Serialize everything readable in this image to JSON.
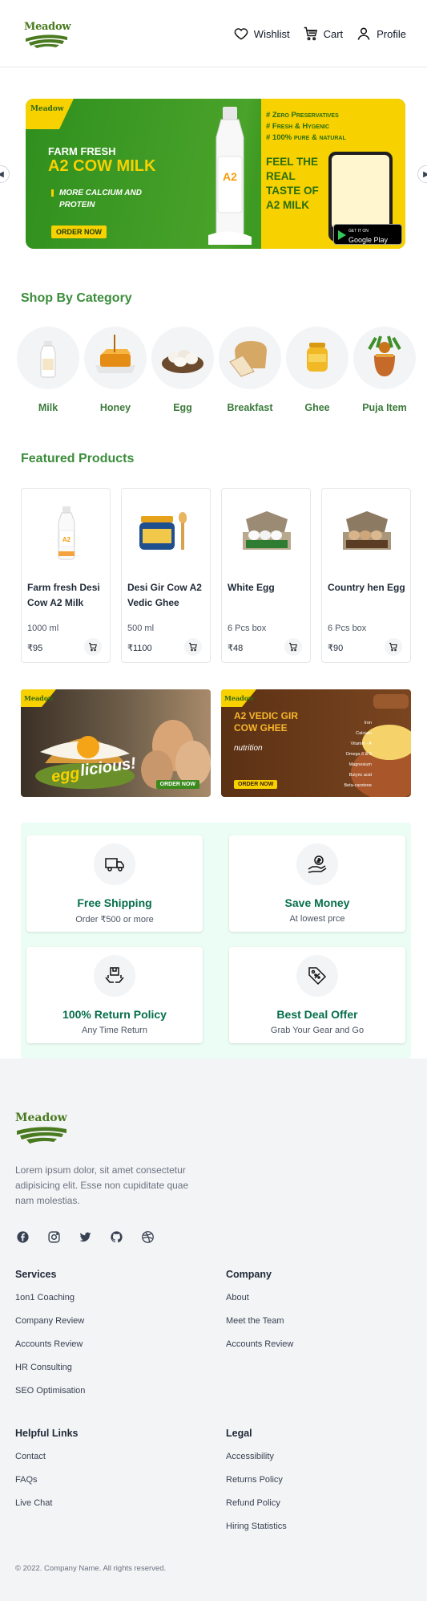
{
  "header": {
    "logo": "Meadow",
    "nav": [
      {
        "label": "Wishlist",
        "icon": "heart-icon"
      },
      {
        "label": "Cart",
        "icon": "cart-icon"
      },
      {
        "label": "Profile",
        "icon": "user-icon"
      }
    ]
  },
  "banner": {
    "badge": "Meadow",
    "line1": "FARM FRESH",
    "line2": "A2 COW MILK",
    "sub": "MORE CALCIUM AND PROTEIN",
    "cta": "ORDER NOW",
    "points": [
      "# Zero Preservatives",
      "# Fresh & Hygenic",
      "# 100% pure & natural"
    ],
    "feel": "FEEL THE REAL TASTE OF A2 MILK",
    "store_small": "GET IT ON",
    "store": "Google Play",
    "colors": {
      "green": "#3d9a22",
      "yellow": "#f7d100"
    }
  },
  "categories": {
    "title": "Shop By Category",
    "items": [
      {
        "label": "Milk"
      },
      {
        "label": "Honey"
      },
      {
        "label": "Egg"
      },
      {
        "label": "Breakfast"
      },
      {
        "label": "Ghee"
      },
      {
        "label": "Puja Item"
      }
    ]
  },
  "featured": {
    "title": "Featured Products",
    "products": [
      {
        "name": "Farm fresh Desi Cow A2 Milk",
        "unit": "1000 ml",
        "price": "₹95"
      },
      {
        "name": "Desi Gir Cow A2 Vedic Ghee",
        "unit": "500 ml",
        "price": "₹1100"
      },
      {
        "name": "White Egg",
        "unit": "6 Pcs box",
        "price": "₹48"
      },
      {
        "name": "Country hen Egg",
        "unit": "6 Pcs box",
        "price": "₹90"
      }
    ]
  },
  "promos": [
    {
      "text1": "egg",
      "text2": "licious!",
      "cta": "ORDER NOW",
      "badge": "Meadow"
    },
    {
      "title": "A2 VEDIC GIR COW GHEE",
      "sub": "nutrition",
      "cta": "ORDER NOW",
      "badge": "Meadow",
      "nutrients": [
        "Iron",
        "Calcium",
        "Vitamin - A",
        "Omega 6 & 9",
        "Magnesium",
        "Butyric acid",
        "Beta-carotene"
      ]
    }
  ],
  "features": [
    {
      "title": "Free Shipping",
      "sub": "Order ₹500 or more",
      "icon": "truck-icon"
    },
    {
      "title": "Save Money",
      "sub": "At lowest prce",
      "icon": "money-hand-icon"
    },
    {
      "title": "100% Return Policy",
      "sub": "Any Time Return",
      "icon": "return-box-icon"
    },
    {
      "title": "Best Deal Offer",
      "sub": "Grab Your Gear and Go",
      "icon": "discount-tag-icon"
    }
  ],
  "footer": {
    "logo": "Meadow",
    "description": "Lorem ipsum dolor, sit amet consectetur adipisicing elit. Esse non cupiditate quae nam molestias.",
    "columns": [
      {
        "title": "Services",
        "links": [
          "1on1 Coaching",
          "Company Review",
          "Accounts Review",
          "HR Consulting",
          "SEO Optimisation"
        ]
      },
      {
        "title": "Company",
        "links": [
          "About",
          "Meet the Team",
          "Accounts Review"
        ]
      },
      {
        "title": "Helpful Links",
        "links": [
          "Contact",
          "FAQs",
          "Live Chat"
        ]
      },
      {
        "title": "Legal",
        "links": [
          "Accessibility",
          "Returns Policy",
          "Refund Policy",
          "Hiring Statistics"
        ]
      }
    ],
    "copyright": "© 2022. Company Name. All rights reserved."
  }
}
